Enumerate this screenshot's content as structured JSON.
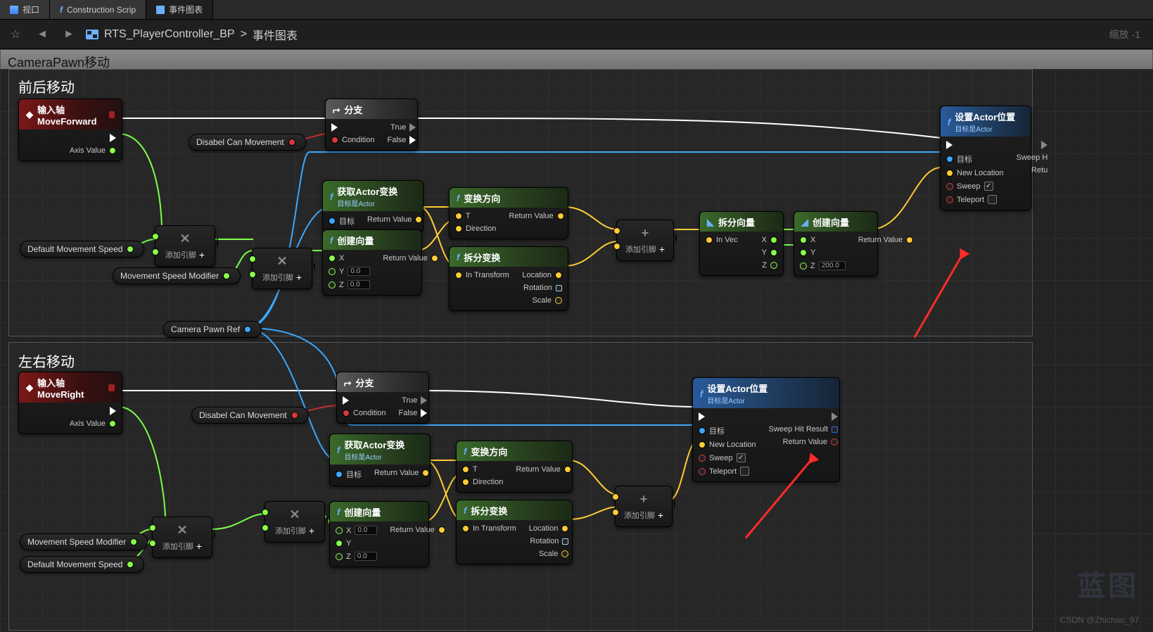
{
  "tabs": [
    {
      "label": "视口",
      "icon": "viewport-icon"
    },
    {
      "label": "Construction Scrip",
      "icon": "fn-icon"
    },
    {
      "label": "事件图表",
      "icon": "graph-icon",
      "active": true
    }
  ],
  "breadcrumb": {
    "blueprint": "RTS_PlayerController_BP",
    "sep": ">",
    "graph": "事件图表"
  },
  "zoom": "缩放 -1",
  "comment_title": "CameraPawn移动",
  "sections": {
    "fwd": "前后移动",
    "side": "左右移动"
  },
  "events": {
    "fwd": {
      "title": "输入轴MoveForward",
      "axis": "Axis Value"
    },
    "side": {
      "title": "输入轴MoveRight",
      "axis": "Axis Value"
    }
  },
  "branch": {
    "title": "分支",
    "cond": "Condition",
    "t": "True",
    "f": "False"
  },
  "vars": {
    "disabel": "Disabel Can Movement",
    "defSpeed": "Default Movement Speed",
    "speedMod": "Movement Speed Modifier",
    "camRef": "Camera Pawn Ref"
  },
  "addpin": "添加引脚",
  "getActor": {
    "title": "获取Actor变换",
    "sub": "目标是Actor",
    "target": "目标",
    "ret": "Return Value"
  },
  "makeVec": {
    "title": "创建向量",
    "x": "X",
    "y": "Y",
    "z": "Z",
    "ret": "Return Value",
    "val": "0.0",
    "zfix": "200.0"
  },
  "transDir": {
    "title": "变换方向",
    "t": "T",
    "dir": "Direction",
    "ret": "Return Value"
  },
  "breakT": {
    "title": "拆分变换",
    "in": "In Transform",
    "loc": "Location",
    "rot": "Rotation",
    "scale": "Scale"
  },
  "breakV": {
    "title": "拆分向量",
    "in": "In Vec",
    "x": "X",
    "y": "Y",
    "z": "Z"
  },
  "setLoc": {
    "title": "设置Actor位置",
    "sub": "目标是Actor",
    "target": "目标",
    "newLoc": "New Location",
    "sweep": "Sweep",
    "teleport": "Teleport",
    "sweepHit": "Sweep Hit Result",
    "sweepHitShort": "Sweep H",
    "ret": "Return Value",
    "retShort": "Retu"
  },
  "watermark": "蓝图",
  "credit": "CSDN @Zhichao_97"
}
